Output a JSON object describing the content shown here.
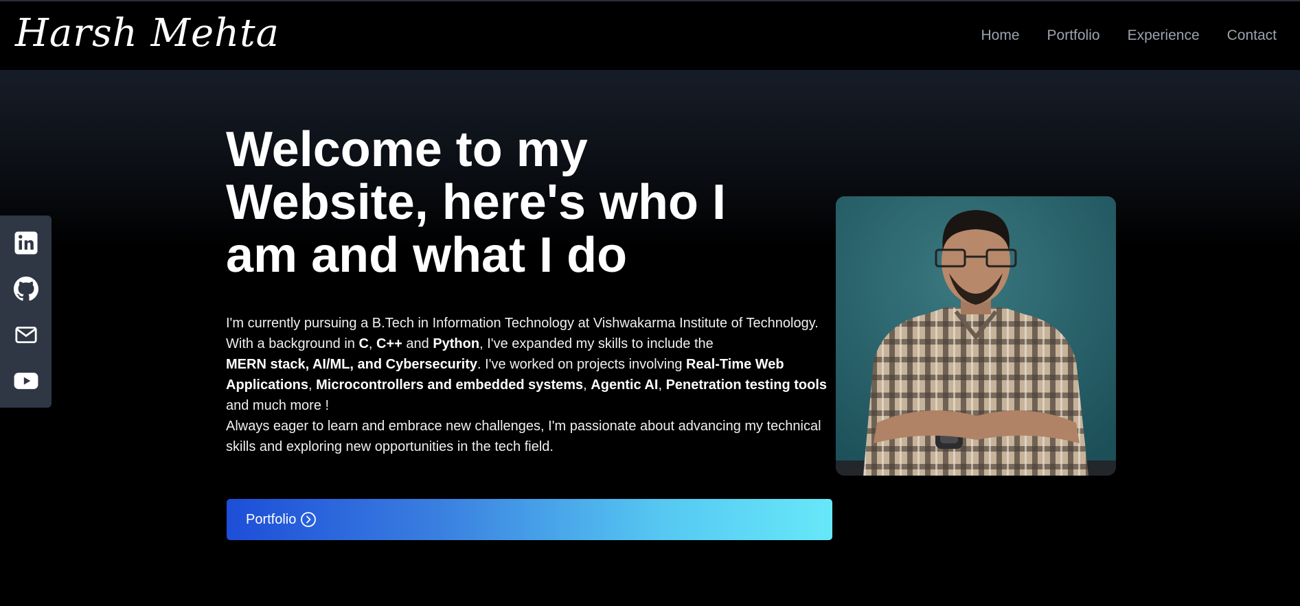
{
  "header": {
    "logo": "Harsh Mehta",
    "nav": [
      {
        "label": "Home"
      },
      {
        "label": "Portfolio"
      },
      {
        "label": "Experience"
      },
      {
        "label": "Contact"
      }
    ]
  },
  "social": {
    "icons": [
      "linkedin-icon",
      "github-icon",
      "mail-icon",
      "youtube-icon"
    ]
  },
  "hero": {
    "heading": "Welcome to my Website, here's who I am and what I do",
    "desc": {
      "t1": "I'm currently pursuing a B.Tech in Information Technology at Vishwakarma Institute of Technology. With a background in ",
      "c": "C",
      "t2": ", ",
      "cpp": "C++",
      "t3": " and ",
      "python": "Python",
      "t4": ", I've expanded my skills to include the ",
      "stack": "MERN stack, AI/ML, and Cybersecurity",
      "t5": ". I've worked on projects involving ",
      "rtwa": "Real-Time Web Applications",
      "t6": ", ",
      "micro": "Microcontrollers and embedded systems",
      "t7": ", ",
      "agentic": "Agentic AI",
      "t8": ", ",
      "pentest": "Penetration testing tools",
      "t9": " and much more !",
      "p2": "Always eager to learn and embrace new challenges, I'm passionate about advancing my technical skills and exploring new opportunities in the tech field."
    },
    "button_label": "Portfolio"
  },
  "colors": {
    "background": "#000000",
    "nav_text": "#9ca3af",
    "social_panel": "#2f3745",
    "button_start": "#1d4ed8",
    "button_end": "#67e8f9"
  }
}
